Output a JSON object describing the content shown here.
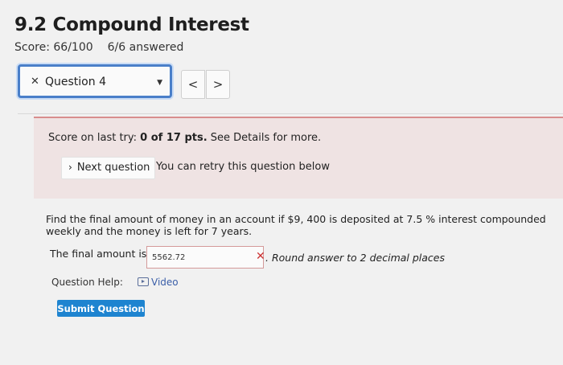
{
  "header": {
    "title": "9.2 Compound Interest",
    "score": "Score: 66/100",
    "answered": "6/6 answered"
  },
  "question_nav": {
    "current": "Question 4",
    "prev_label": "<",
    "next_label": ">"
  },
  "notice": {
    "prefix": "Score on last try: ",
    "score": "0 of 17 pts.",
    "suffix": " See Details for more.",
    "next_question_label": "Next question",
    "retry_text": "You can retry this question below"
  },
  "problem": {
    "text": "Find the final amount of money in an account if $9, 400 is deposited at 7.5 % interest compounded weekly and the money is left for 7 years."
  },
  "answer": {
    "label": "The final amount is $",
    "value": "5562.72",
    "note": ". Round answer to 2 decimal places"
  },
  "help": {
    "label": "Question Help:",
    "video_label": "Video"
  },
  "submit_label": "Submit Question",
  "colors": {
    "accent": "#1e84d0",
    "select_border": "#4a7fc9",
    "notice_bg": "#efe3e3",
    "error": "#cc3333"
  }
}
